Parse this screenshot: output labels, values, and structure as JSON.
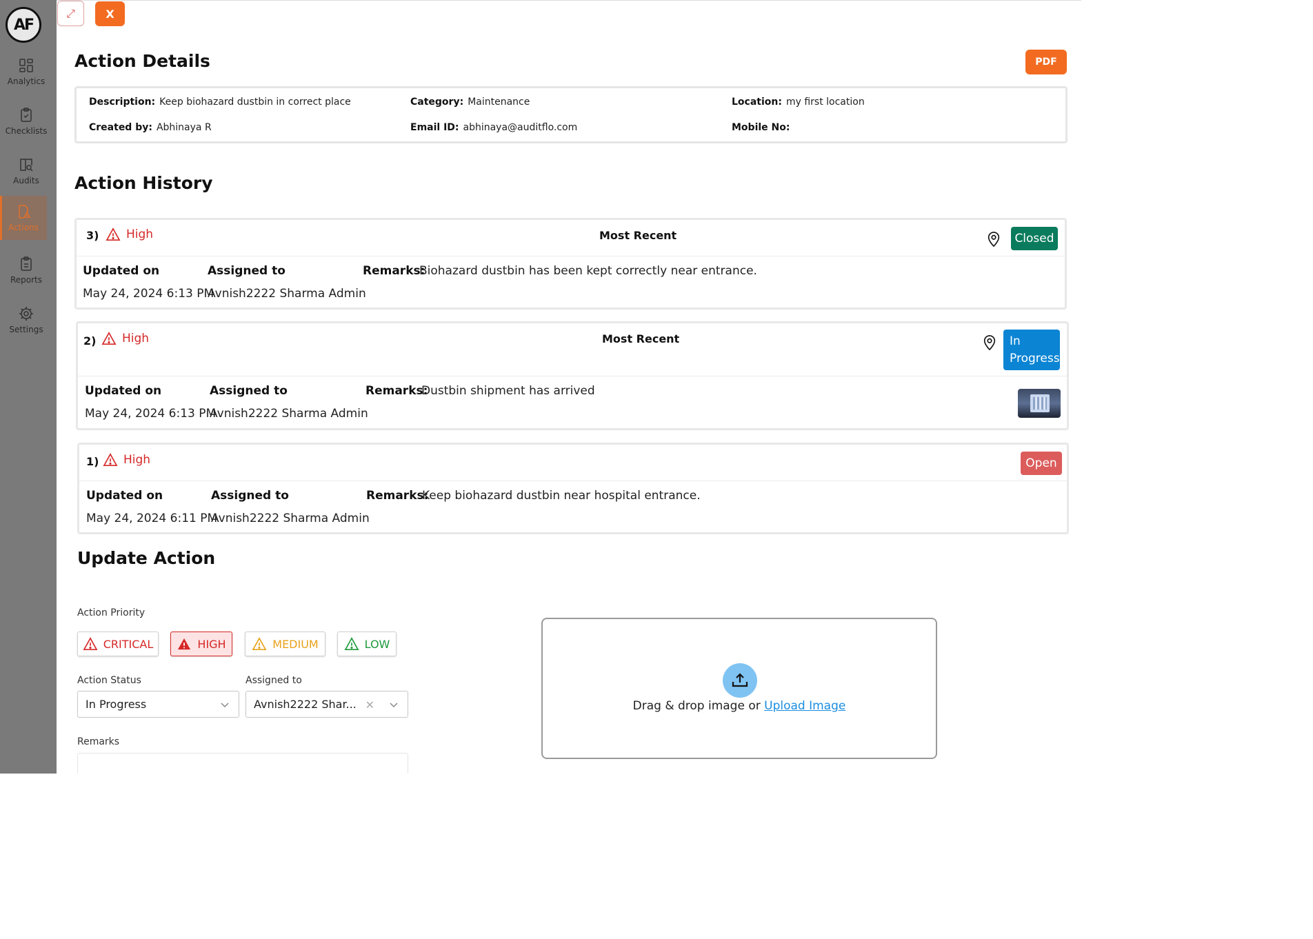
{
  "sidebar": {
    "logo": "AF",
    "items": [
      {
        "label": "Analytics",
        "icon": "analytics-icon"
      },
      {
        "label": "Checklists",
        "icon": "checklist-icon"
      },
      {
        "label": "Audits",
        "icon": "audit-icon"
      },
      {
        "label": "Actions",
        "icon": "actions-icon",
        "active": true
      },
      {
        "label": "Reports",
        "icon": "reports-icon"
      },
      {
        "label": "Settings",
        "icon": "gear-icon"
      }
    ]
  },
  "topbar": {
    "expand_icon": "expand-icon",
    "close_label": "X"
  },
  "details": {
    "title": "Action Details",
    "pdf_label": "PDF",
    "description_label": "Description:",
    "description": "Keep biohazard dustbin in correct place",
    "category_label": "Category:",
    "category": "Maintenance",
    "location_label": "Location:",
    "location": "my first location",
    "created_by_label": "Created by:",
    "created_by": "Abhinaya R",
    "email_label": "Email ID:",
    "email": "abhinaya@auditflo.com",
    "mobile_label": "Mobile No:"
  },
  "history": {
    "title": "Action History",
    "updated_label": "Updated on",
    "assigned_label": "Assigned to",
    "remarks_label": "Remarks:",
    "entries": [
      {
        "num": "3)",
        "priority": "High",
        "tag": "Most Recent",
        "status": "Closed",
        "updated": "May 24, 2024 6:13 PM",
        "assigned": "Avnish2222 Sharma Admin",
        "remarks": "Biohazard dustbin has been kept correctly near entrance."
      },
      {
        "num": "2)",
        "priority": "High",
        "tag": "Most Recent",
        "status_line1": "In",
        "status_line2": "Progress",
        "updated": "May 24, 2024 6:13 PM",
        "assigned": "Avnish2222 Sharma Admin",
        "remarks": "Dustbin shipment has arrived"
      },
      {
        "num": "1)",
        "priority": "High",
        "status": "Open",
        "updated": "May 24, 2024 6:11 PM",
        "assigned": "Avnish2222 Sharma Admin",
        "remarks": "Keep biohazard dustbin near hospital entrance."
      }
    ]
  },
  "update": {
    "title": "Update Action",
    "priority_label": "Action Priority",
    "priorities": [
      "CRITICAL",
      "HIGH",
      "MEDIUM",
      "LOW"
    ],
    "selected_priority": "HIGH",
    "status_label": "Action Status",
    "status_value": "In Progress",
    "assigned_label": "Assigned to",
    "assigned_value": "Avnish2222 Shar...",
    "remarks_label": "Remarks",
    "drop_text": "Drag & drop image or ",
    "upload_link": "Upload Image"
  },
  "colors": {
    "accent": "#f26b21",
    "closed": "#0a7b5c",
    "in_progress": "#0b84d4",
    "open": "#dc5c5c",
    "priority_red": "#d62828",
    "medium": "#e8a21a",
    "low": "#1e9a3c"
  }
}
